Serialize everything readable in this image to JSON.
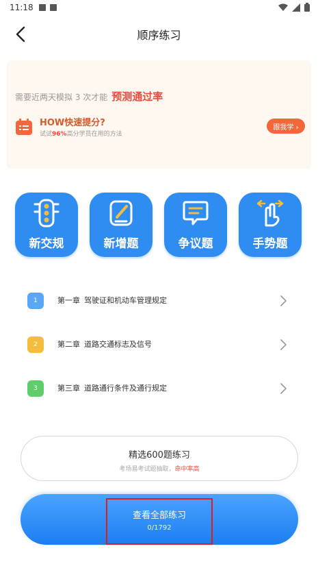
{
  "status_bar": {
    "time": "11:18"
  },
  "nav": {
    "title": "顺序练习"
  },
  "promo": {
    "hint": "需要近两天模拟 3 次才能",
    "rate_label": "预测通过率",
    "headline": "HOW快速提分?",
    "sub_prefix": "试试",
    "sub_highlight": "96%",
    "sub_suffix": "高分学员在用的方法",
    "follow_label": "跟我学 ›"
  },
  "categories": [
    {
      "label": "新交规",
      "icon": "traffic-light-icon"
    },
    {
      "label": "新增题",
      "icon": "edit-icon"
    },
    {
      "label": "争议题",
      "icon": "chat-icon"
    },
    {
      "label": "手势题",
      "icon": "hand-gesture-icon"
    }
  ],
  "chapters": [
    {
      "badge": "1",
      "num": "第一章",
      "title": "驾驶证和机动车管理规定",
      "color": "#5aa8f5"
    },
    {
      "badge": "2",
      "num": "第二章",
      "title": "道路交通标志及信号",
      "color": "#f5bd3c"
    },
    {
      "badge": "3",
      "num": "第三章",
      "title": "道路通行条件及通行规定",
      "color": "#5fce6a"
    }
  ],
  "select600": {
    "title": "精选600题练习",
    "sub_prefix": "考场易考试题抽取，",
    "sub_highlight": "命中率高"
  },
  "all_practice": {
    "title": "查看全部练习",
    "count": "0/1792"
  },
  "colors": {
    "primary": "#2f8cf0",
    "accent": "#e84a3c",
    "orange": "#f2683a"
  }
}
